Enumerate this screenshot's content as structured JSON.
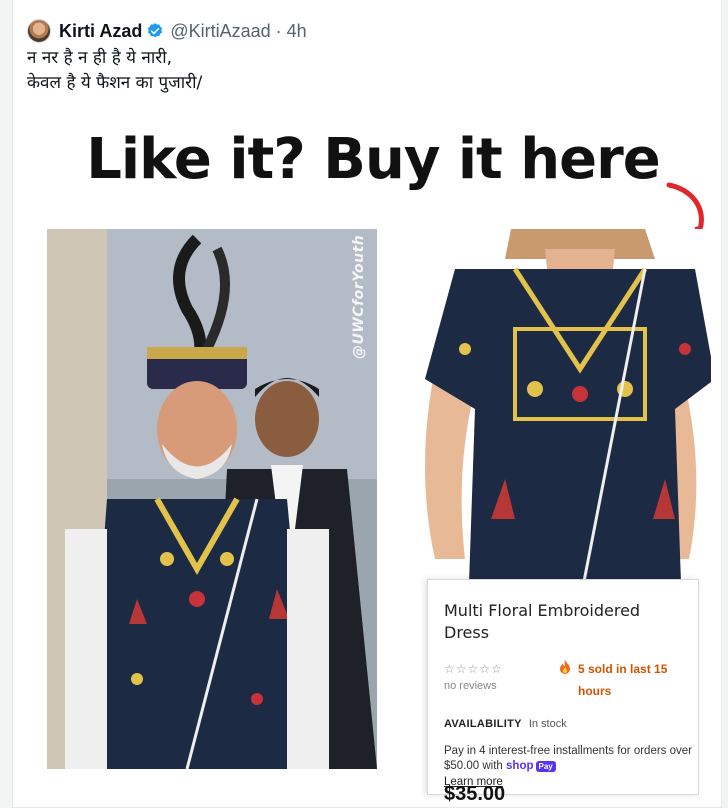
{
  "tweet": {
    "author_name": "Kirti Azad",
    "handle": "@KirtiAzaad",
    "separator": "·",
    "time": "4h",
    "text_line1": "न नर है न ही है ये नारी,",
    "text_line2": "केवल है ये फैशन का पुजारी/"
  },
  "media": {
    "headline": "Like it? Buy it here",
    "watermark": "@UWCforYouth"
  },
  "product": {
    "title": "Multi Floral Embroidered Dress",
    "stars": "☆☆☆☆☆",
    "reviews": "no reviews",
    "sold": "5 sold in last 15 hours",
    "availability_label": "AVAILABILITY",
    "availability_value": "In stock",
    "installments": "Pay in 4 interest-free installments for orders over $50.00 with",
    "shop_word": "shop",
    "pay_word": "Pay",
    "learn_more": "Learn more",
    "price": "$35.00"
  },
  "icons": {
    "verified": "verified-badge-icon",
    "fire": "fire-icon",
    "arrow": "curved-arrow-icon"
  },
  "colors": {
    "verified_blue": "#1d9bf0",
    "dress_navy": "#1d2a44",
    "sold_orange": "#d35400",
    "arrow_red": "#e0282c",
    "shop_purple": "#5a31f4"
  }
}
